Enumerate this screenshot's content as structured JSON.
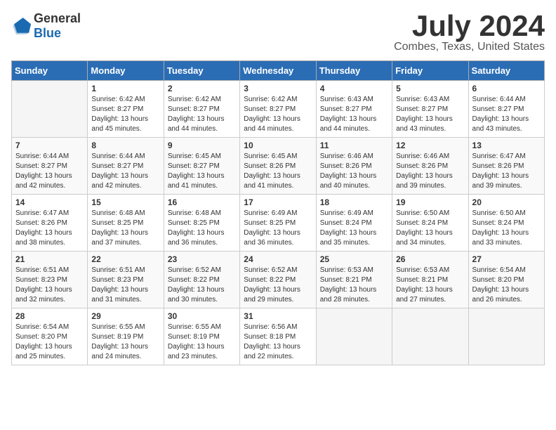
{
  "header": {
    "logo_general": "General",
    "logo_blue": "Blue",
    "month_year": "July 2024",
    "location": "Combes, Texas, United States"
  },
  "weekdays": [
    "Sunday",
    "Monday",
    "Tuesday",
    "Wednesday",
    "Thursday",
    "Friday",
    "Saturday"
  ],
  "weeks": [
    [
      {
        "day": "",
        "sunrise": "",
        "sunset": "",
        "daylight": ""
      },
      {
        "day": "1",
        "sunrise": "Sunrise: 6:42 AM",
        "sunset": "Sunset: 8:27 PM",
        "daylight": "Daylight: 13 hours and 45 minutes."
      },
      {
        "day": "2",
        "sunrise": "Sunrise: 6:42 AM",
        "sunset": "Sunset: 8:27 PM",
        "daylight": "Daylight: 13 hours and 44 minutes."
      },
      {
        "day": "3",
        "sunrise": "Sunrise: 6:42 AM",
        "sunset": "Sunset: 8:27 PM",
        "daylight": "Daylight: 13 hours and 44 minutes."
      },
      {
        "day": "4",
        "sunrise": "Sunrise: 6:43 AM",
        "sunset": "Sunset: 8:27 PM",
        "daylight": "Daylight: 13 hours and 44 minutes."
      },
      {
        "day": "5",
        "sunrise": "Sunrise: 6:43 AM",
        "sunset": "Sunset: 8:27 PM",
        "daylight": "Daylight: 13 hours and 43 minutes."
      },
      {
        "day": "6",
        "sunrise": "Sunrise: 6:44 AM",
        "sunset": "Sunset: 8:27 PM",
        "daylight": "Daylight: 13 hours and 43 minutes."
      }
    ],
    [
      {
        "day": "7",
        "sunrise": "Sunrise: 6:44 AM",
        "sunset": "Sunset: 8:27 PM",
        "daylight": "Daylight: 13 hours and 42 minutes."
      },
      {
        "day": "8",
        "sunrise": "Sunrise: 6:44 AM",
        "sunset": "Sunset: 8:27 PM",
        "daylight": "Daylight: 13 hours and 42 minutes."
      },
      {
        "day": "9",
        "sunrise": "Sunrise: 6:45 AM",
        "sunset": "Sunset: 8:27 PM",
        "daylight": "Daylight: 13 hours and 41 minutes."
      },
      {
        "day": "10",
        "sunrise": "Sunrise: 6:45 AM",
        "sunset": "Sunset: 8:26 PM",
        "daylight": "Daylight: 13 hours and 41 minutes."
      },
      {
        "day": "11",
        "sunrise": "Sunrise: 6:46 AM",
        "sunset": "Sunset: 8:26 PM",
        "daylight": "Daylight: 13 hours and 40 minutes."
      },
      {
        "day": "12",
        "sunrise": "Sunrise: 6:46 AM",
        "sunset": "Sunset: 8:26 PM",
        "daylight": "Daylight: 13 hours and 39 minutes."
      },
      {
        "day": "13",
        "sunrise": "Sunrise: 6:47 AM",
        "sunset": "Sunset: 8:26 PM",
        "daylight": "Daylight: 13 hours and 39 minutes."
      }
    ],
    [
      {
        "day": "14",
        "sunrise": "Sunrise: 6:47 AM",
        "sunset": "Sunset: 8:26 PM",
        "daylight": "Daylight: 13 hours and 38 minutes."
      },
      {
        "day": "15",
        "sunrise": "Sunrise: 6:48 AM",
        "sunset": "Sunset: 8:25 PM",
        "daylight": "Daylight: 13 hours and 37 minutes."
      },
      {
        "day": "16",
        "sunrise": "Sunrise: 6:48 AM",
        "sunset": "Sunset: 8:25 PM",
        "daylight": "Daylight: 13 hours and 36 minutes."
      },
      {
        "day": "17",
        "sunrise": "Sunrise: 6:49 AM",
        "sunset": "Sunset: 8:25 PM",
        "daylight": "Daylight: 13 hours and 36 minutes."
      },
      {
        "day": "18",
        "sunrise": "Sunrise: 6:49 AM",
        "sunset": "Sunset: 8:24 PM",
        "daylight": "Daylight: 13 hours and 35 minutes."
      },
      {
        "day": "19",
        "sunrise": "Sunrise: 6:50 AM",
        "sunset": "Sunset: 8:24 PM",
        "daylight": "Daylight: 13 hours and 34 minutes."
      },
      {
        "day": "20",
        "sunrise": "Sunrise: 6:50 AM",
        "sunset": "Sunset: 8:24 PM",
        "daylight": "Daylight: 13 hours and 33 minutes."
      }
    ],
    [
      {
        "day": "21",
        "sunrise": "Sunrise: 6:51 AM",
        "sunset": "Sunset: 8:23 PM",
        "daylight": "Daylight: 13 hours and 32 minutes."
      },
      {
        "day": "22",
        "sunrise": "Sunrise: 6:51 AM",
        "sunset": "Sunset: 8:23 PM",
        "daylight": "Daylight: 13 hours and 31 minutes."
      },
      {
        "day": "23",
        "sunrise": "Sunrise: 6:52 AM",
        "sunset": "Sunset: 8:22 PM",
        "daylight": "Daylight: 13 hours and 30 minutes."
      },
      {
        "day": "24",
        "sunrise": "Sunrise: 6:52 AM",
        "sunset": "Sunset: 8:22 PM",
        "daylight": "Daylight: 13 hours and 29 minutes."
      },
      {
        "day": "25",
        "sunrise": "Sunrise: 6:53 AM",
        "sunset": "Sunset: 8:21 PM",
        "daylight": "Daylight: 13 hours and 28 minutes."
      },
      {
        "day": "26",
        "sunrise": "Sunrise: 6:53 AM",
        "sunset": "Sunset: 8:21 PM",
        "daylight": "Daylight: 13 hours and 27 minutes."
      },
      {
        "day": "27",
        "sunrise": "Sunrise: 6:54 AM",
        "sunset": "Sunset: 8:20 PM",
        "daylight": "Daylight: 13 hours and 26 minutes."
      }
    ],
    [
      {
        "day": "28",
        "sunrise": "Sunrise: 6:54 AM",
        "sunset": "Sunset: 8:20 PM",
        "daylight": "Daylight: 13 hours and 25 minutes."
      },
      {
        "day": "29",
        "sunrise": "Sunrise: 6:55 AM",
        "sunset": "Sunset: 8:19 PM",
        "daylight": "Daylight: 13 hours and 24 minutes."
      },
      {
        "day": "30",
        "sunrise": "Sunrise: 6:55 AM",
        "sunset": "Sunset: 8:19 PM",
        "daylight": "Daylight: 13 hours and 23 minutes."
      },
      {
        "day": "31",
        "sunrise": "Sunrise: 6:56 AM",
        "sunset": "Sunset: 8:18 PM",
        "daylight": "Daylight: 13 hours and 22 minutes."
      },
      {
        "day": "",
        "sunrise": "",
        "sunset": "",
        "daylight": ""
      },
      {
        "day": "",
        "sunrise": "",
        "sunset": "",
        "daylight": ""
      },
      {
        "day": "",
        "sunrise": "",
        "sunset": "",
        "daylight": ""
      }
    ]
  ]
}
